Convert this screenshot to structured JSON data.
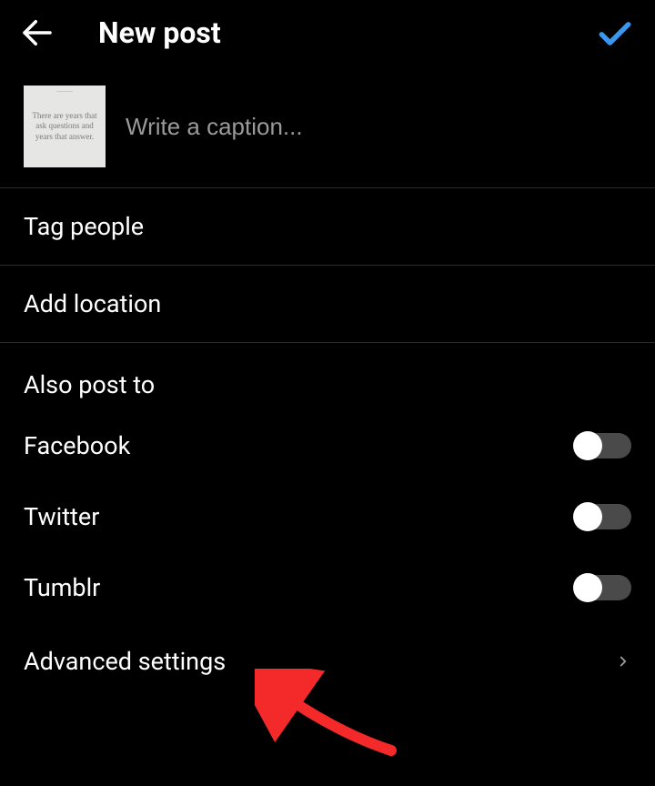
{
  "header": {
    "title": "New post"
  },
  "caption": {
    "placeholder": "Write a caption...",
    "value": "",
    "thumb_text": "There are years that ask questions and years that answer."
  },
  "rows": {
    "tag_people": "Tag people",
    "add_location": "Add location",
    "advanced_settings": "Advanced settings"
  },
  "share": {
    "section_label": "Also post to",
    "targets": [
      {
        "label": "Facebook",
        "enabled": false
      },
      {
        "label": "Twitter",
        "enabled": false
      },
      {
        "label": "Tumblr",
        "enabled": false
      }
    ]
  }
}
